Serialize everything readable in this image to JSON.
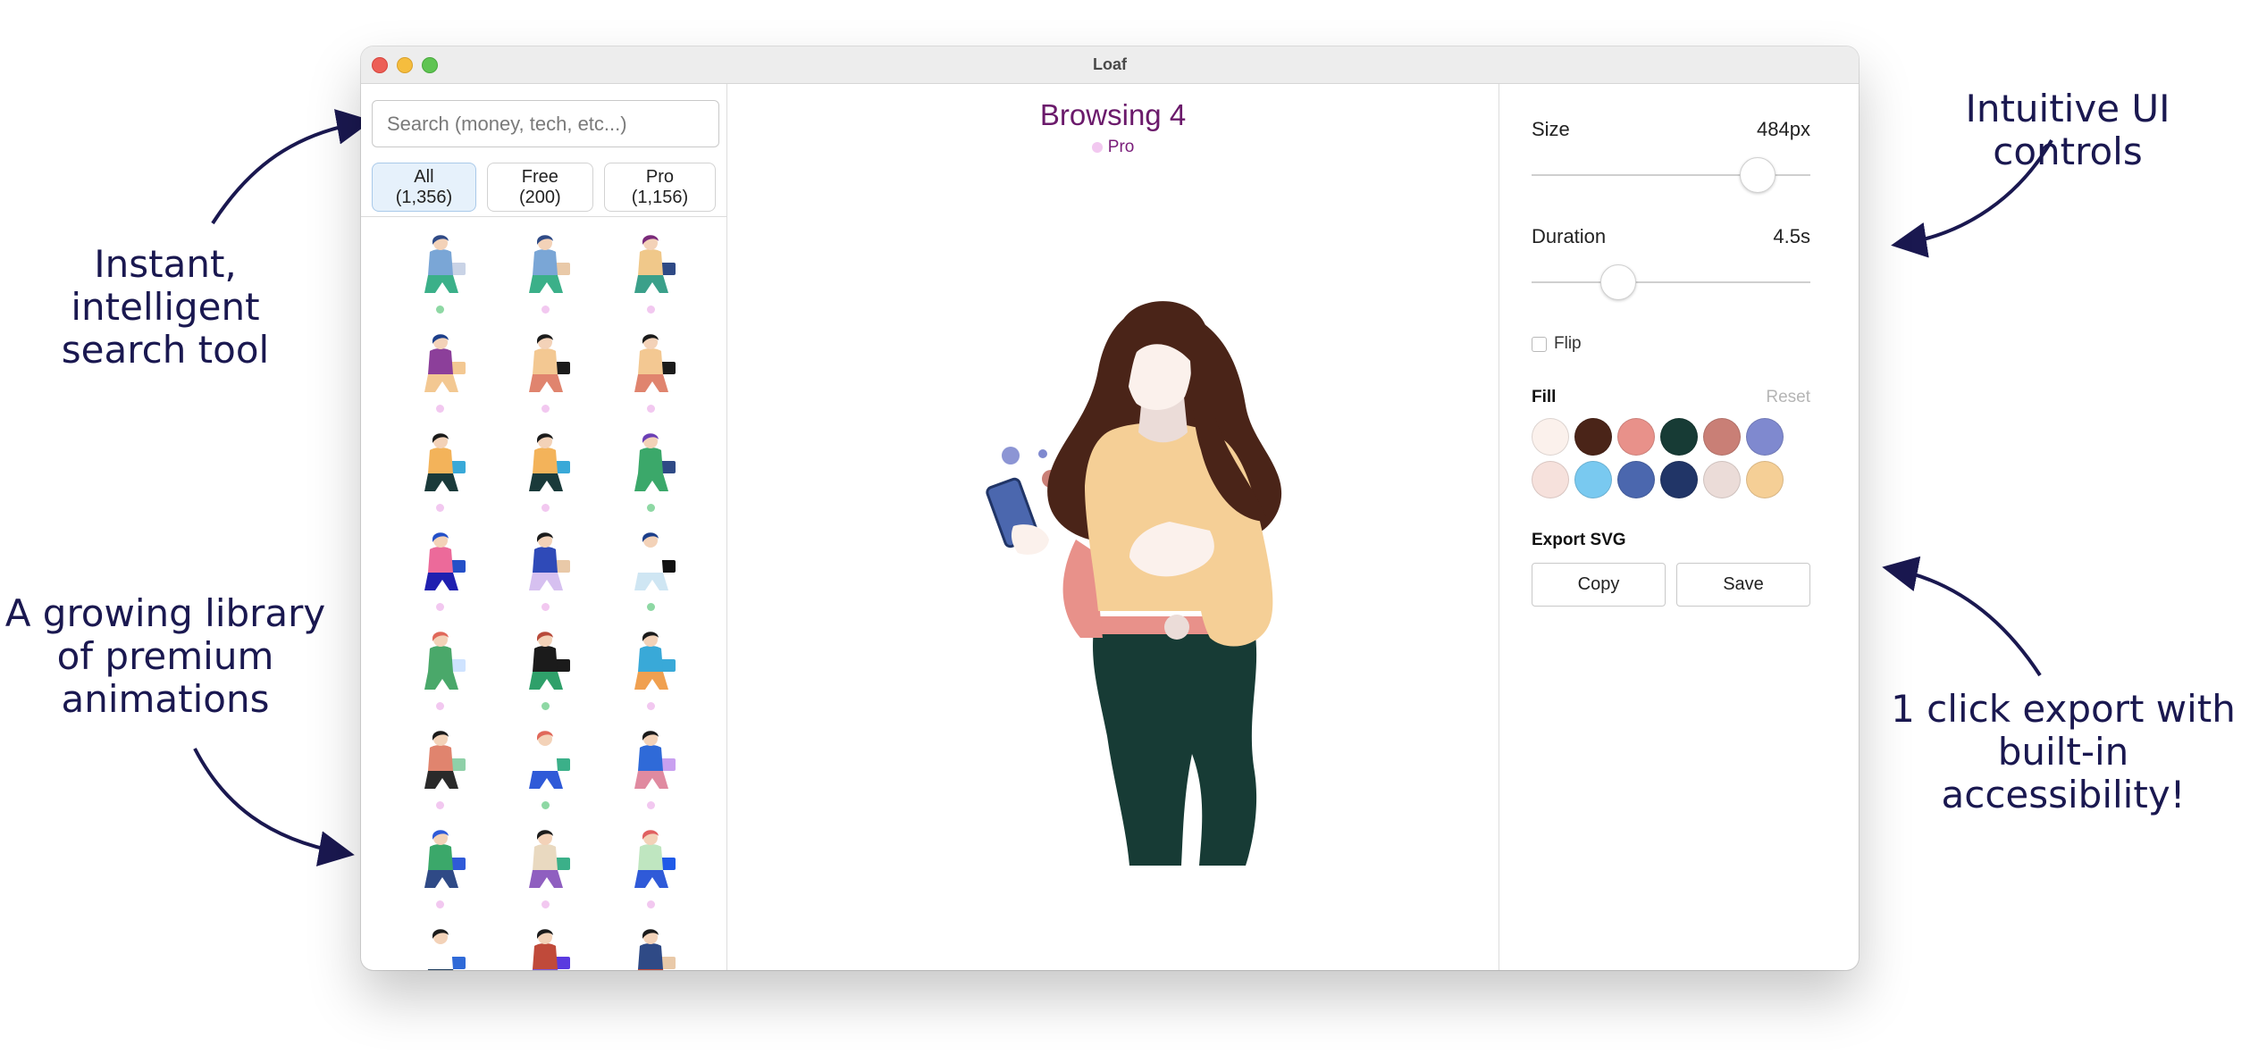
{
  "window": {
    "title": "Loaf"
  },
  "annotations": {
    "search": [
      "Instant, intelligent",
      "search tool"
    ],
    "library": [
      "A growing library",
      "of premium",
      "animations"
    ],
    "ui": [
      "Intuitive UI controls"
    ],
    "export": [
      "1 click export with",
      "built-in accessibility!"
    ]
  },
  "sidebar": {
    "search_placeholder": "Search (money, tech, etc...)",
    "filters": [
      {
        "label": "All (1,356)",
        "active": true
      },
      {
        "label": "Free (200)",
        "active": false
      },
      {
        "label": "Pro (1,156)",
        "active": false
      }
    ],
    "thumbnails": [
      {
        "tier": "free",
        "hair": "#2f4a86",
        "top": "#7aa6d6",
        "bottom": "#3bb089",
        "prop": "#c9d3e6"
      },
      {
        "tier": "pro",
        "hair": "#2f4a86",
        "top": "#7aa6d6",
        "bottom": "#3bb089",
        "prop": "#e9c9a8"
      },
      {
        "tier": "pro",
        "hair": "#7a2a7a",
        "top": "#f0c88a",
        "bottom": "#3ba08a",
        "prop": "#2f4a86"
      },
      {
        "tier": "pro",
        "hair": "#1d3f8a",
        "top": "#8c3f9a",
        "bottom": "#f3c892",
        "prop": "#f3c892"
      },
      {
        "tier": "pro",
        "hair": "#1b1b1b",
        "top": "#f3c892",
        "bottom": "#e0846e",
        "prop": "#1b1b1b"
      },
      {
        "tier": "pro",
        "hair": "#1b1b1b",
        "top": "#f3c892",
        "bottom": "#e0846e",
        "prop": "#1b1b1b"
      },
      {
        "tier": "pro",
        "hair": "#1b1b1b",
        "top": "#f3b35a",
        "bottom": "#1a3a3a",
        "prop": "#39a9d8"
      },
      {
        "tier": "pro",
        "hair": "#1b1b1b",
        "top": "#f3b35a",
        "bottom": "#1a3a3a",
        "prop": "#39a9d8"
      },
      {
        "tier": "free",
        "hair": "#6b3fb5",
        "top": "#3ba86a",
        "bottom": "#3ba86a",
        "prop": "#2f4a86"
      },
      {
        "tier": "pro",
        "hair": "#2450c8",
        "top": "#ec6a9a",
        "bottom": "#2020b0",
        "prop": "#2450c8"
      },
      {
        "tier": "pro",
        "hair": "#1b1b1b",
        "top": "#2f4ab8",
        "bottom": "#d6c0f0",
        "prop": "#e9c9a8"
      },
      {
        "tier": "free",
        "hair": "#1d3f8a",
        "top": "#ffffff",
        "bottom": "#cfe6f3",
        "prop": "#111111"
      },
      {
        "tier": "pro",
        "hair": "#e0685a",
        "top": "#4aa86a",
        "bottom": "#4aa86a",
        "prop": "#cfe3ff"
      },
      {
        "tier": "free",
        "hair": "#b84a3a",
        "top": "#1b1b1b",
        "bottom": "#2fa06a",
        "prop": "#1b1b1b"
      },
      {
        "tier": "pro",
        "hair": "#1b1b1b",
        "top": "#39a9d8",
        "bottom": "#f0a050",
        "prop": "#39a9d8"
      },
      {
        "tier": "pro",
        "hair": "#1b1b1b",
        "top": "#e0846e",
        "bottom": "#2a2a2a",
        "prop": "#8fd0a8"
      },
      {
        "tier": "free",
        "hair": "#e0685a",
        "top": "#ffffff",
        "bottom": "#2f5ad8",
        "prop": "#3bb089"
      },
      {
        "tier": "pro",
        "hair": "#1b1b1b",
        "top": "#2f6ad8",
        "bottom": "#e08aa0",
        "prop": "#c9a0f0"
      },
      {
        "tier": "pro",
        "hair": "#2f5ad8",
        "top": "#3ba86a",
        "bottom": "#2f4a86",
        "prop": "#2f5ad8"
      },
      {
        "tier": "pro",
        "hair": "#1b1b1b",
        "top": "#e9d9c0",
        "bottom": "#8f5fc0",
        "prop": "#3bb089"
      },
      {
        "tier": "pro",
        "hair": "#e06060",
        "top": "#bfe6c0",
        "bottom": "#2f5ad8",
        "prop": "#1f5ae8"
      },
      {
        "tier": "pro",
        "hair": "#1b1b1b",
        "top": "#ffffff",
        "bottom": "#1a3a5a",
        "prop": "#2f6ad8"
      },
      {
        "tier": "pro",
        "hair": "#1b1b1b",
        "top": "#c04a3a",
        "bottom": "#7a5ad8",
        "prop": "#5a3ae0"
      },
      {
        "tier": "pro",
        "hair": "#1b1b1b",
        "top": "#2f4a86",
        "bottom": "#c04a3a",
        "prop": "#e9c9a8"
      }
    ]
  },
  "preview": {
    "title": "Browsing 4",
    "tag": "Pro"
  },
  "controls": {
    "size": {
      "label": "Size",
      "value": "484px",
      "fraction": 0.81
    },
    "duration": {
      "label": "Duration",
      "value": "4.5s",
      "fraction": 0.31
    },
    "flip": {
      "label": "Flip",
      "checked": false
    },
    "fill": {
      "label": "Fill",
      "reset_label": "Reset",
      "colors": [
        "#fbf1ec",
        "#4a2418",
        "#e8918a",
        "#173b35",
        "#c97f76",
        "#7f89cf",
        "#f6e1dc",
        "#79c9f0",
        "#4b67ae",
        "#213567",
        "#ebdcd8",
        "#f5cf96"
      ]
    },
    "export": {
      "label": "Export SVG",
      "copy_label": "Copy",
      "save_label": "Save"
    }
  },
  "tier_colors": {
    "free": "#8ed8a4",
    "pro": "#f2c8f0"
  }
}
